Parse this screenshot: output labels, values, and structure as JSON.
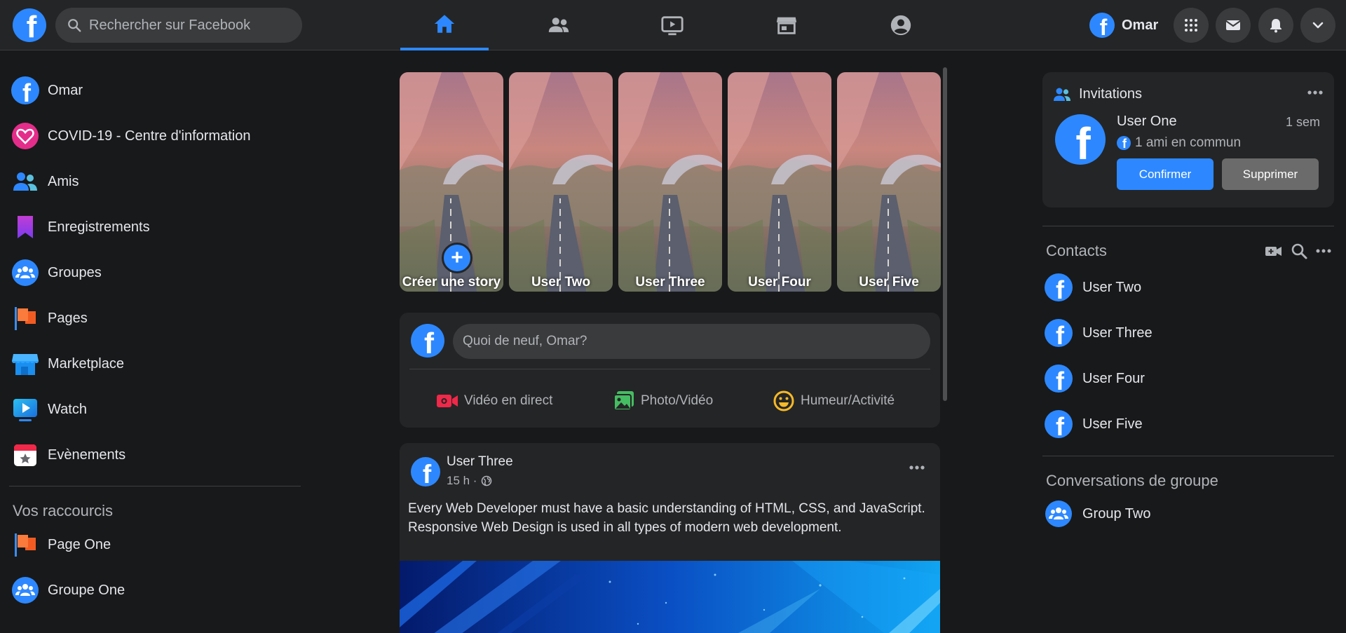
{
  "topbar": {
    "logo_letter": "f",
    "search_placeholder": "Rechercher sur Facebook",
    "user_name": "Omar",
    "nav_tabs": [
      "home",
      "friends",
      "watch",
      "marketplace",
      "groups"
    ]
  },
  "left": {
    "items": [
      {
        "label": "Omar",
        "icon": "fb-avatar-icon"
      },
      {
        "label": "COVID-19 - Centre d'information",
        "icon": "heart-icon"
      },
      {
        "label": "Amis",
        "icon": "friends-icon"
      },
      {
        "label": "Enregistrements",
        "icon": "bookmark-icon"
      },
      {
        "label": "Groupes",
        "icon": "groups-icon"
      },
      {
        "label": "Pages",
        "icon": "flag-icon"
      },
      {
        "label": "Marketplace",
        "icon": "store-icon"
      },
      {
        "label": "Watch",
        "icon": "video-icon"
      },
      {
        "label": "Evènements",
        "icon": "calendar-icon"
      }
    ],
    "shortcuts_title": "Vos raccourcis",
    "shortcuts": [
      {
        "label": "Page One",
        "icon": "flag-icon"
      },
      {
        "label": "Groupe One",
        "icon": "groups-icon"
      }
    ]
  },
  "stories": [
    {
      "label": "Créer une story",
      "create": true
    },
    {
      "label": "User Two"
    },
    {
      "label": "User Three"
    },
    {
      "label": "User Four"
    },
    {
      "label": "User Five"
    }
  ],
  "composer": {
    "placeholder": "Quoi de neuf, Omar?",
    "actions": [
      "Vidéo en direct",
      "Photo/Vidéo",
      "Humeur/Activité"
    ]
  },
  "post": {
    "author": "User Three",
    "time": "15 h ·",
    "text_line1": "Every Web Developer must have a basic understanding of HTML, CSS, and JavaScript.",
    "text_line2": "Responsive Web Design is used in all types of modern web development."
  },
  "invitations": {
    "title": "Invitations",
    "user": "User One",
    "time": "1 sem",
    "mutual": "1 ami en commun",
    "confirm": "Confirmer",
    "delete": "Supprimer"
  },
  "contacts": {
    "title": "Contacts",
    "list": [
      "User Two",
      "User Three",
      "User Four",
      "User Five"
    ]
  },
  "group_conversations": {
    "title": "Conversations de groupe",
    "list": [
      "Group Two"
    ]
  },
  "colors": {
    "background": "#18191a",
    "surface": "#242526",
    "accent": "#2d88ff",
    "text": "#e4e6eb",
    "muted": "#b0b3b8"
  }
}
